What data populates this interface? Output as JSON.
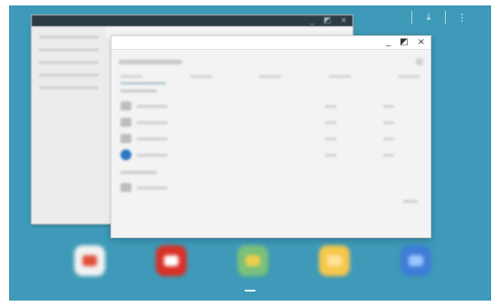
{
  "screen": {
    "colors": {
      "wallpaper": "#3e9ab8",
      "window_bg": "#f3f3f3"
    }
  },
  "status_bar": {
    "icons": [
      "download-icon",
      "overflow-menu-icon"
    ],
    "download_glyph": "⤓",
    "menu_glyph": "⋮"
  },
  "windows": {
    "foreground": {
      "controls": {
        "minimize": "_",
        "maximize": "◩",
        "close": "×"
      }
    },
    "background": {
      "controls": {
        "minimize": "_",
        "maximize": "◩",
        "close": "×"
      }
    }
  },
  "dock": {
    "icons": [
      {
        "name": "calendar-icon",
        "color": "#f2f2f2",
        "inner": "#e24d3a"
      },
      {
        "name": "youtube-icon",
        "color": "#d93025",
        "inner": "#ffffff"
      },
      {
        "name": "maps-icon",
        "color": "#7ac07a",
        "inner": "#f0d04a"
      },
      {
        "name": "notes-icon",
        "color": "#f5c74c",
        "inner": "#ffe39a"
      },
      {
        "name": "internet-icon",
        "color": "#3f7cd6",
        "inner": "#9ec7ff"
      }
    ]
  },
  "right_icons": [
    {
      "name": "app-icon-red",
      "color": "#e35a4f"
    },
    {
      "name": "app-icon-blue",
      "color": "#2f7fd0"
    },
    {
      "name": "play-store-icon",
      "color": "#9a4fa8"
    },
    {
      "name": "chrome-icon",
      "color": "#e67f2f"
    }
  ]
}
